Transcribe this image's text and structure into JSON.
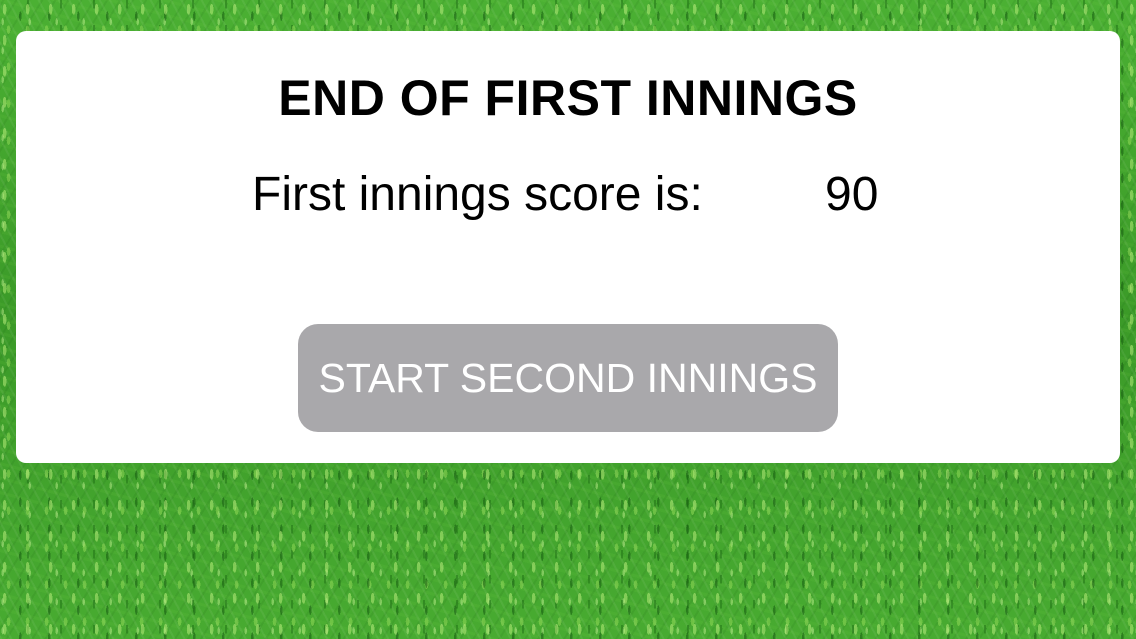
{
  "screen": {
    "title": "END OF FIRST INNINGS",
    "score_label": "First innings score is:",
    "score_value": "90",
    "start_button_label": "START SECOND INNINGS"
  },
  "background": {
    "texture": "grass"
  },
  "colors": {
    "panel": "#ffffff",
    "button": "#a9a8ab",
    "button_text": "#ffffff",
    "text": "#000000",
    "grass": "#42a22c"
  }
}
